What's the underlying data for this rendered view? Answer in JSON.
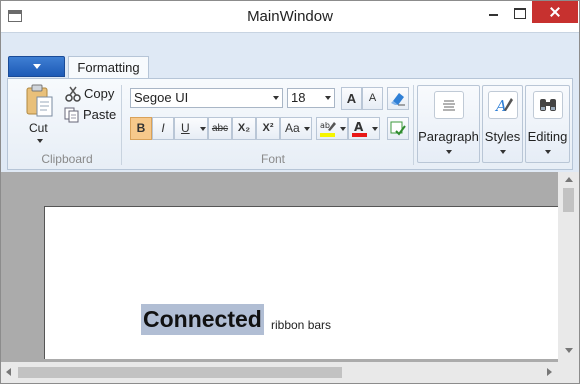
{
  "window": {
    "title": "MainWindow"
  },
  "ribbon": {
    "tabs": [
      {
        "label": "Formatting"
      }
    ],
    "groups": {
      "clipboard": {
        "label": "Clipboard",
        "cut": "Cut",
        "copy": "Copy",
        "paste": "Paste"
      },
      "font": {
        "label": "Font",
        "font_family": "Segoe UI",
        "font_size": "18",
        "bold": "B",
        "italic": "I",
        "underline": "U",
        "strike": "abc",
        "subscript": "X₂",
        "superscript": "X²",
        "change_case": "Aa",
        "grow": "A",
        "shrink": "A"
      },
      "paragraph": {
        "label": "Paragraph"
      },
      "styles": {
        "label": "Styles"
      },
      "editing": {
        "label": "Editing"
      }
    }
  },
  "document": {
    "highlighted_text": "Connected",
    "text": "ribbon bars"
  },
  "colors": {
    "highlight": "#b1bed4",
    "close_button": "#c7312f",
    "app_menu": "#1d5ab6",
    "bold_active": "#f7c98b",
    "font_color_bar": "#e81717",
    "highlighter_bar": "#f5f500"
  },
  "icons": {
    "app": "window-icon",
    "paste": "clipboard-paste-icon",
    "cut": "scissors-icon",
    "copy": "copy-icon",
    "paste_small": "paste-icon",
    "grow_font": "grow-font-icon",
    "shrink_font": "shrink-font-icon",
    "clear_formatting": "eraser-icon",
    "highlighter": "highlighter-icon",
    "font_color": "font-color-icon",
    "paragraph": "paragraph-lines-icon",
    "styles": "styles-pen-icon",
    "editing": "binoculars-icon"
  }
}
